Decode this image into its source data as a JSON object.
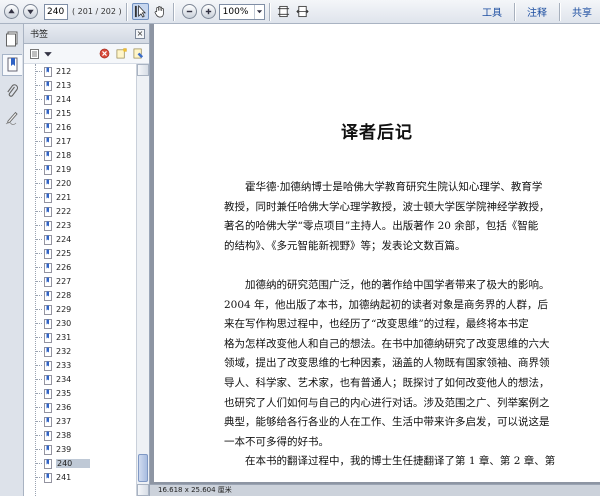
{
  "toolbar": {
    "current_page": "240",
    "page_count_text": "( 201 / 202 )",
    "zoom": "100%",
    "links": {
      "tools": "工具",
      "comment": "注释",
      "share": "共享"
    }
  },
  "panel": {
    "title": "书签",
    "close_label": "×",
    "bookmarks": [
      "212",
      "213",
      "214",
      "215",
      "216",
      "217",
      "218",
      "219",
      "220",
      "221",
      "222",
      "223",
      "224",
      "225",
      "226",
      "227",
      "228",
      "229",
      "230",
      "231",
      "232",
      "233",
      "234",
      "235",
      "236",
      "237",
      "238",
      "239",
      "240",
      "241"
    ],
    "selected": "240"
  },
  "document": {
    "title": "译者后记",
    "paragraphs": [
      [
        "　　霍华德·加德纳博士是哈佛大学教育研究生院认知心理学、教育学",
        "教授，同时兼任哈佛大学心理学教授，波士顿大学医学院神经学教授，",
        "著名的哈佛大学“零点项目”主持人。出版著作 20 余部，包括《智能",
        "的结构》、《多元智能新视野》等；发表论文数百篇。"
      ],
      [
        "　　加德纳的研究范围广泛，他的著作给中国学者带来了极大的影响。",
        "2004 年，他出版了本书，加德纳起初的读者对象是商务界的人群，后",
        "来在写作构思过程中，也经历了“改变思维”的过程，最终将本书定",
        "格为怎样改变他人和自己的想法。在书中加德纳研究了改变思维的六大",
        "领域，提出了改变思维的七种因素，涵盖的人物既有国家领袖、商界领",
        "导人、科学家、艺术家，也有普通人；既探讨了如何改变他人的想法，",
        "也研究了人们如何与自己的内心进行对话。涉及范围之广、列举案例之",
        "典型，能够给各行各业的人在工作、生活中带来许多启发，可以说这是",
        "一本不可多得的好书。"
      ],
      [
        "　　在本书的翻译过程中，我的博士生任捷翻译了第 1 章、第 2 章、第"
      ]
    ]
  },
  "status": {
    "page_size": "16.618 x 25.604 厘米"
  }
}
